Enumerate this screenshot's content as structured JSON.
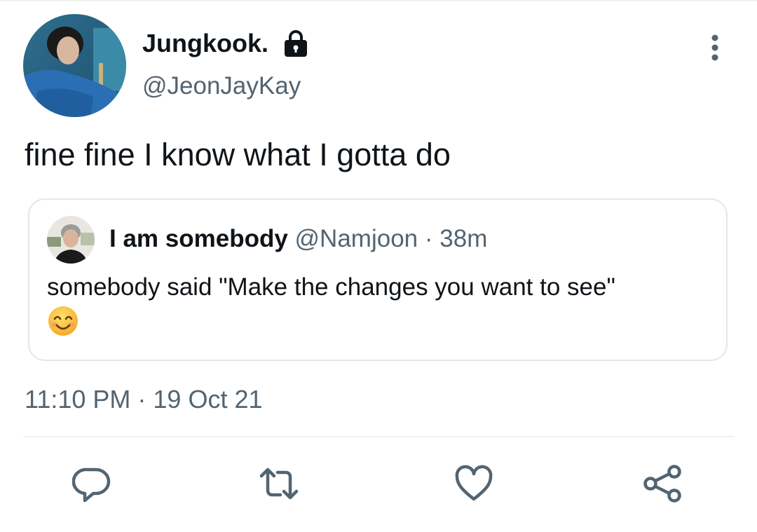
{
  "tweet": {
    "display_name": "Jungkook.",
    "handle": "@JeonJayKay",
    "text": "fine fine I know what I gotta do",
    "timestamp": "11:10 PM · 19 Oct 21",
    "protected_icon": "lock-icon"
  },
  "quote": {
    "display_name": "I am somebody",
    "handle": "@Namjoon",
    "separator": "·",
    "time": "38m",
    "text": "somebody said \"Make the changes you want to see\"",
    "emoji": "smiling-face-emoji"
  },
  "actions": [
    {
      "icon": "reply-icon"
    },
    {
      "icon": "retweet-icon"
    },
    {
      "icon": "like-icon"
    },
    {
      "icon": "share-icon"
    }
  ],
  "colors": {
    "primary_text": "#0f1419",
    "secondary_text": "#536471",
    "border": "#e1e8ed",
    "icon": "#536471"
  }
}
